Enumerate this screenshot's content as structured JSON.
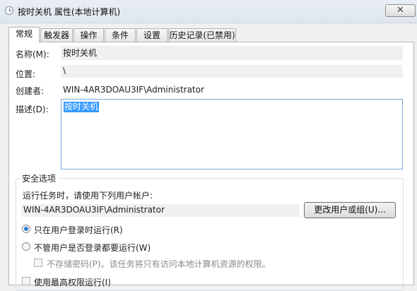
{
  "window": {
    "title": "按时关机 属性(本地计算机)",
    "close": "✕"
  },
  "tabs": [
    "常规",
    "触发器",
    "操作",
    "条件",
    "设置",
    "历史记录(已禁用)"
  ],
  "general": {
    "name_label": "名称(M):",
    "name_value": "按时关机",
    "location_label": "位置:",
    "location_value": "\\",
    "author_label": "创建者:",
    "author_value": "WIN-4AR3DOAU3IF\\Administrator",
    "description_label": "描述(D):",
    "description_value": "按时关机"
  },
  "security": {
    "group_title": "安全选项",
    "run_as_text": "运行任务时，请使用下列用户帐户:",
    "user_account": "WIN-4AR3DOAU3IF\\Administrator",
    "change_button": "更改用户或组(U)...",
    "radio_logged_on": "只在用户登录时运行(R)",
    "radio_logged_on_selected": true,
    "radio_whether": "不管用户是否登录都要运行(W)",
    "no_store_password": "不存储密码(P)。该任务将只有访问本地计算机资源的权限。",
    "highest_privileges": "使用最高权限运行(I)"
  }
}
